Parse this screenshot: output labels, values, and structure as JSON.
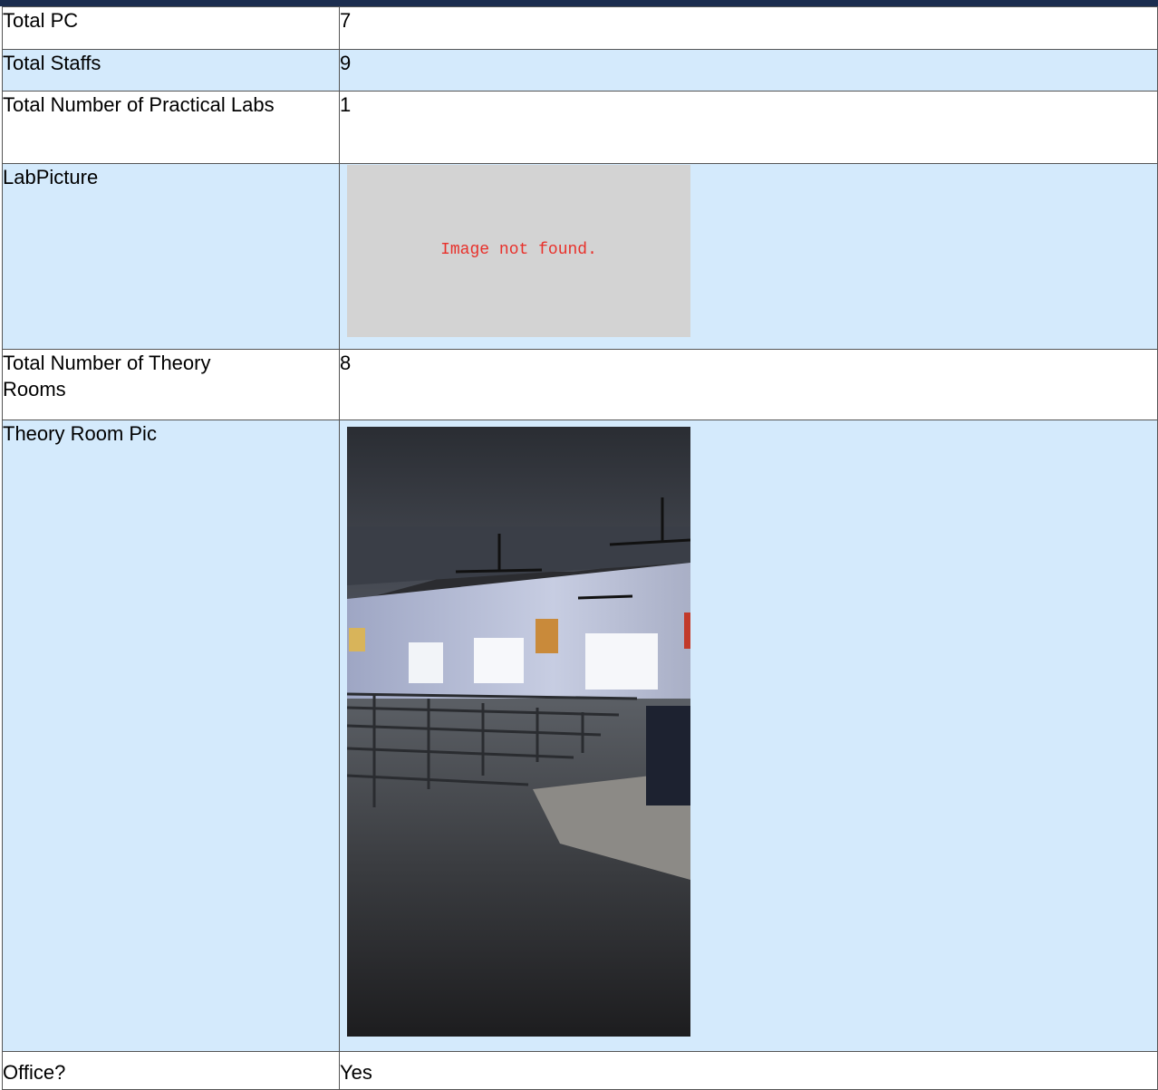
{
  "rows": {
    "total_pc": {
      "label": "Total PC",
      "value": "7"
    },
    "total_staffs": {
      "label": "Total Staffs",
      "value": "9"
    },
    "practical_labs": {
      "label": "Total Number of Practical Labs",
      "value": "1"
    },
    "lab_picture": {
      "label": "LabPicture",
      "placeholder": "Image not found."
    },
    "theory_rooms": {
      "label": "Total Number of Theory Rooms",
      "value": "8"
    },
    "theory_room_pic": {
      "label": "Theory Room Pic"
    },
    "office": {
      "label": "Office?",
      "value": "Yes"
    }
  }
}
